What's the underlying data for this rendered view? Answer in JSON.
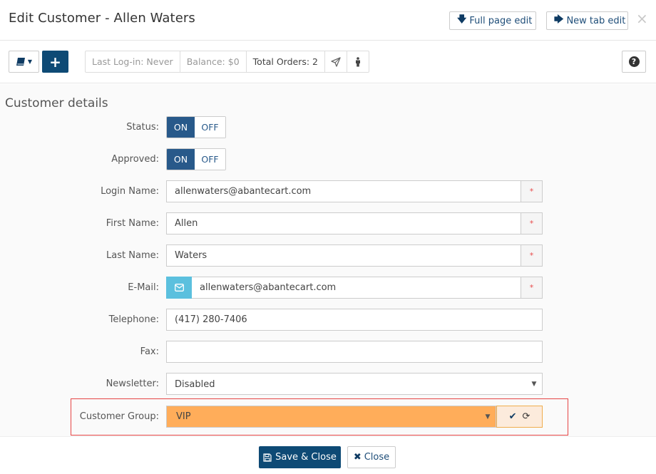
{
  "header": {
    "title": "Edit Customer - Allen Waters",
    "full_page_edit": "Full page edit",
    "new_tab_edit": "New tab edit",
    "close_icon": "×"
  },
  "toolbar": {
    "book_icon": "book-icon",
    "add_label": "+",
    "stats": {
      "last_login": "Last Log-in: Never",
      "balance": "Balance: $0",
      "total_orders": "Total Orders: 2"
    },
    "help_label": "?"
  },
  "form": {
    "section_title": "Customer details",
    "status": {
      "label": "Status:",
      "on": "ON",
      "off": "OFF",
      "value": "ON"
    },
    "approved": {
      "label": "Approved:",
      "on": "ON",
      "off": "OFF",
      "value": "ON"
    },
    "login_name": {
      "label": "Login Name:",
      "value": "allenwaters@abantecart.com",
      "required": "*"
    },
    "first_name": {
      "label": "First Name:",
      "value": "Allen",
      "required": "*"
    },
    "last_name": {
      "label": "Last Name:",
      "value": "Waters",
      "required": "*"
    },
    "email": {
      "label": "E-Mail:",
      "value": "allenwaters@abantecart.com",
      "required": "*"
    },
    "telephone": {
      "label": "Telephone:",
      "value": "(417) 280-7406"
    },
    "fax": {
      "label": "Fax:",
      "value": ""
    },
    "newsletter": {
      "label": "Newsletter:",
      "value": "Disabled"
    },
    "customer_group": {
      "label": "Customer Group:",
      "value": "VIP"
    }
  },
  "footer": {
    "save_close": "Save & Close",
    "close": "Close"
  },
  "colors": {
    "primary": "#0e4a75",
    "toggle_on": "#28598a",
    "email_addon": "#5bc0de",
    "changed_field": "#ffad5a",
    "highlight_border": "#e64545",
    "required": "#e84c4c"
  }
}
